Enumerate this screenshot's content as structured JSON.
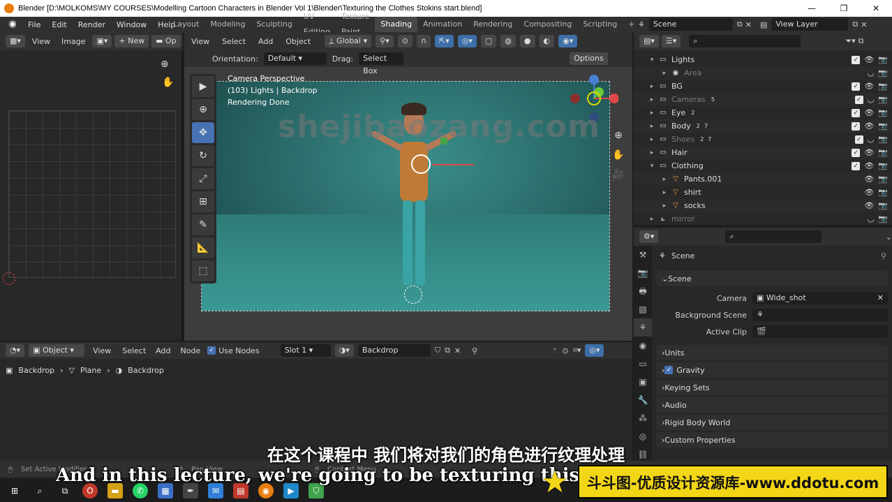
{
  "window": {
    "title": "Blender [D:\\MOLKOMS\\MY COURSES\\Modelling  Cartoon Characters in Blender Vol 1\\Blender\\Texturing the Clothes Stokins start.blend]",
    "minimize": "—",
    "maximize": "❐",
    "close": "✕"
  },
  "menu": [
    "File",
    "Edit",
    "Render",
    "Window",
    "Help"
  ],
  "workspaces": [
    "Layout",
    "Modeling",
    "Sculpting",
    "UV Editing",
    "Texture Paint",
    "Shading",
    "Animation",
    "Rendering",
    "Compositing",
    "Scripting"
  ],
  "active_workspace": "Shading",
  "scene_selector": "Scene",
  "view_layer": "View Layer",
  "image_editor": {
    "view": "View",
    "image": "Image",
    "new": "New",
    "open": "Op"
  },
  "viewport": {
    "view": "View",
    "select": "Select",
    "add": "Add",
    "object": "Object",
    "transform": "Global",
    "orientation_label": "Orientation:",
    "orientation_value": "Default",
    "drag_label": "Drag:",
    "drag_value": "Select Box",
    "options": "Options",
    "overlay_lines": [
      "Camera Perspective",
      "(103) Lights | Backdrop",
      "Rendering Done"
    ]
  },
  "watermark": "shejibaozang.com",
  "node_editor": {
    "mode": "Object",
    "view": "View",
    "select": "Select",
    "add": "Add",
    "node": "Node",
    "use_nodes": "Use Nodes",
    "slot": "Slot 1",
    "material": "Backdrop",
    "breadcrumb": [
      "Backdrop",
      "Plane",
      "Backdrop"
    ]
  },
  "outliner": {
    "rows": [
      {
        "name": "Lights",
        "dim": false,
        "expanded": true
      },
      {
        "name": "Area",
        "dim": true,
        "expanded": false
      },
      {
        "name": "BG",
        "dim": false,
        "expanded": false
      },
      {
        "name": "Cameras",
        "dim": true,
        "expanded": false,
        "badge": "5"
      },
      {
        "name": "Eye",
        "dim": false,
        "expanded": false,
        "badge": "2"
      },
      {
        "name": "Body",
        "dim": false,
        "expanded": false,
        "badge": "2",
        "badge2": "7"
      },
      {
        "name": "Shoes",
        "dim": true,
        "expanded": false,
        "badge": "2",
        "badge2": "7"
      },
      {
        "name": "Hair",
        "dim": false,
        "expanded": false
      },
      {
        "name": "Clothing",
        "dim": false,
        "expanded": true
      },
      {
        "name": "Pants.001",
        "dim": false,
        "expanded": false
      },
      {
        "name": "shirt",
        "dim": false,
        "expanded": false
      },
      {
        "name": "socks",
        "dim": false,
        "expanded": false
      },
      {
        "name": "mirror",
        "dim": true,
        "expanded": false
      }
    ]
  },
  "properties": {
    "context": "Scene",
    "panel_scene": "Scene",
    "camera_label": "Camera",
    "camera_value": "Wide_shot",
    "bg_scene_label": "Background Scene",
    "bg_scene_value": "",
    "active_clip_label": "Active Clip",
    "active_clip_value": "",
    "panels": [
      "Units",
      "Gravity",
      "Keying Sets",
      "Audio",
      "Rigid Body World",
      "Custom Properties"
    ]
  },
  "statusbar": {
    "left": "Set Active Modifier",
    "mid": "Pan View",
    "right": "Context Menu"
  },
  "subtitles": {
    "cn": "在这个课程中 我们将对我们的角色进行纹理处理",
    "en": "And in this lecture, we're going to be texturing this to"
  },
  "brand": "斗斗图-优质设计资源库-www.ddotu.com",
  "colors": {
    "accent": "#4772b3",
    "blender_orange": "#e87d0d",
    "render_teal": "#2f7c78",
    "brand_yellow": "#f3d616"
  }
}
